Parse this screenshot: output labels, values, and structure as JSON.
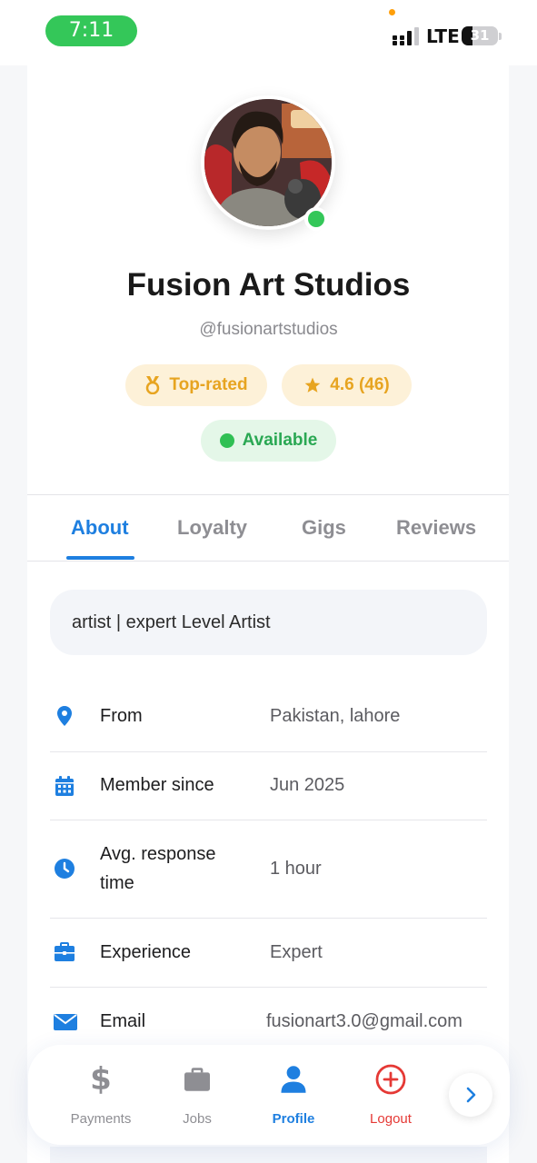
{
  "status_bar": {
    "time": "7:11",
    "network": "LTE",
    "battery": "31",
    "battery_level": 0.31
  },
  "profile": {
    "name": "Fusion Art Studios",
    "handle": "@fusionartstudios",
    "online": true,
    "badges": {
      "top_rated": "Top-rated",
      "rating": "4.6 (46)",
      "availability": "Available"
    }
  },
  "tabs": [
    {
      "label": "About",
      "active": true
    },
    {
      "label": "Loyalty",
      "active": false
    },
    {
      "label": "Gigs",
      "active": false
    },
    {
      "label": "Reviews",
      "active": false
    }
  ],
  "about": {
    "bio": "artist | expert Level Artist",
    "rows": [
      {
        "icon": "location-pin-icon",
        "label": "From",
        "value": "Pakistan, lahore"
      },
      {
        "icon": "calendar-icon",
        "label": "Member since",
        "value": "Jun 2025"
      },
      {
        "icon": "clock-icon",
        "label": "Avg. response time",
        "label_line1": "Avg. response",
        "label_line2": "time",
        "value": "1 hour"
      },
      {
        "icon": "briefcase-icon",
        "label": "Experience",
        "value": "Expert"
      },
      {
        "icon": "mail-icon",
        "label": "Email",
        "value": "fusionart3.0@gmail.com"
      }
    ]
  },
  "bottom_nav": {
    "items": [
      {
        "label": "Payments",
        "icon": "dollar-icon"
      },
      {
        "label": "Jobs",
        "icon": "briefcase-icon"
      },
      {
        "label": "Profile",
        "icon": "person-icon",
        "active": true
      },
      {
        "label": "Logout",
        "icon": "logout-plus-icon"
      }
    ],
    "next_icon": "chevron-right-icon"
  },
  "colors": {
    "accent": "#1e7fe0",
    "online": "#34c759",
    "badge_gold": "#e7a420",
    "logout": "#e53935"
  }
}
